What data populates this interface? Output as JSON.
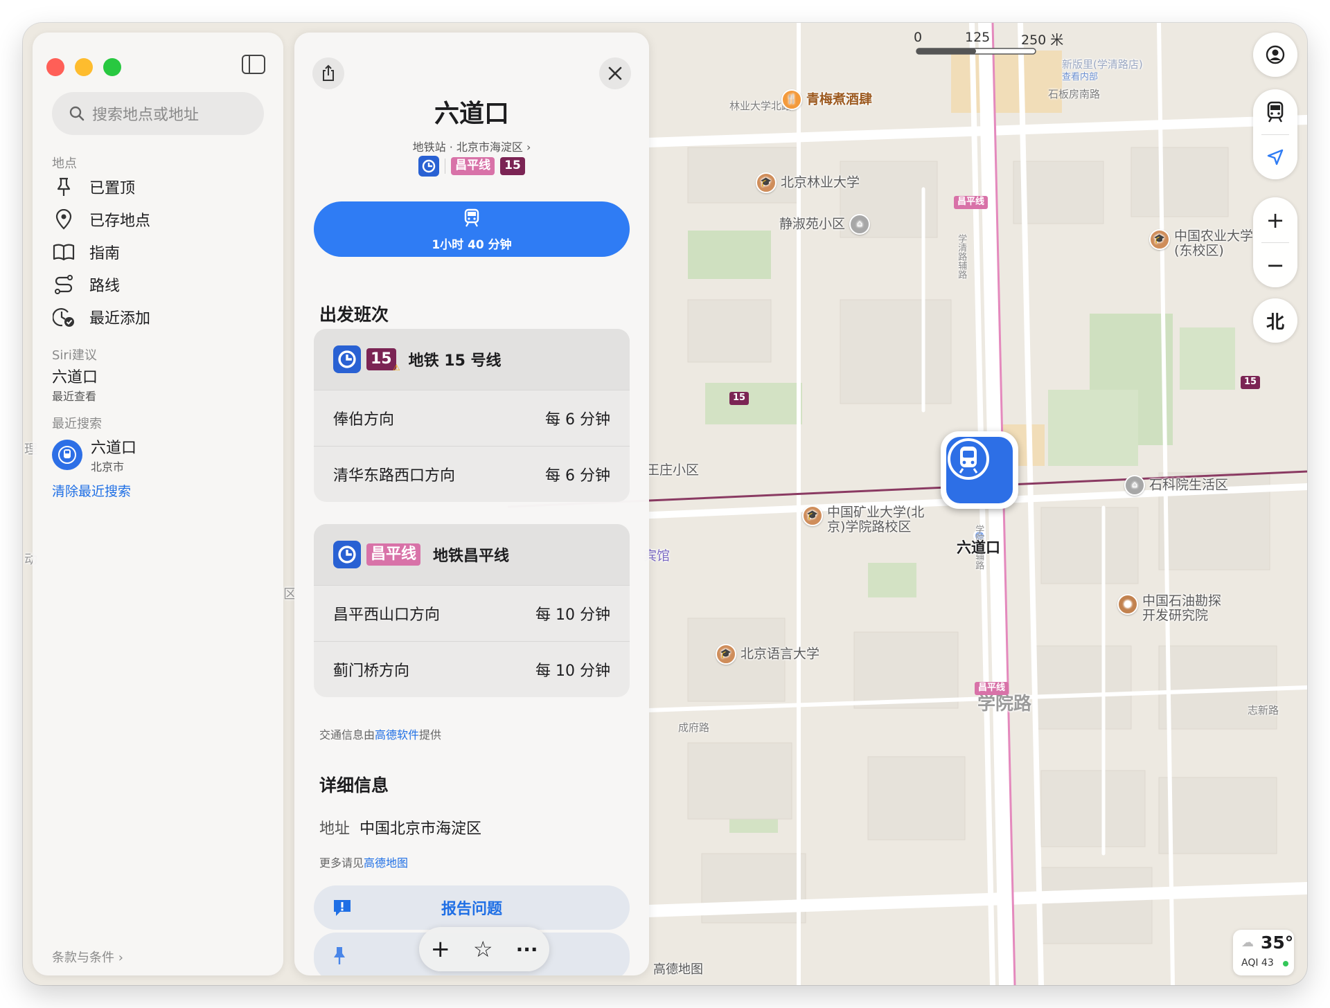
{
  "window": {
    "traffic_colors": {
      "close": "#ff5f57",
      "minimize": "#febc2e",
      "zoom": "#28c840"
    }
  },
  "sidebar": {
    "search_placeholder": "搜索地点或地址",
    "places_heading": "地点",
    "items": [
      {
        "label": "已置顶",
        "icon": "pin-icon"
      },
      {
        "label": "已存地点",
        "icon": "location-pin-icon"
      },
      {
        "label": "指南",
        "icon": "book-icon"
      },
      {
        "label": "路线",
        "icon": "route-icon"
      },
      {
        "label": "最近添加",
        "icon": "clock-check-icon"
      }
    ],
    "siri_heading": "Siri建议",
    "siri_item": {
      "title": "六道口",
      "subtitle": "最近查看"
    },
    "recent_heading": "最近搜索",
    "recent_item": {
      "title": "六道口",
      "subtitle": "北京市"
    },
    "clear_recent": "清除最近搜索",
    "terms": "条款与条件 ›"
  },
  "panel": {
    "title": "六道口",
    "subtitle": "地铁站 · 北京市海淀区 ›",
    "badge_changping": "昌平线",
    "badge_15": "15",
    "route_button": "1小时 40 分钟",
    "departures_heading": "出发班次",
    "lines": [
      {
        "badge": "15",
        "name": "地铁 15 号线",
        "color": "#7b2454",
        "directions": [
          {
            "direction": "俸伯方向",
            "frequency": "每 6 分钟"
          },
          {
            "direction": "清华东路西口方向",
            "frequency": "每 6 分钟"
          }
        ]
      },
      {
        "badge": "昌平线",
        "name": "地铁昌平线",
        "color": "#d872a8",
        "directions": [
          {
            "direction": "昌平西山口方向",
            "frequency": "每 10 分钟"
          },
          {
            "direction": "蓟门桥方向",
            "frequency": "每 10 分钟"
          }
        ]
      }
    ],
    "provider_prefix": "交通信息由",
    "provider_link": "高德软件",
    "provider_suffix": "提供",
    "details_heading": "详细信息",
    "address_label": "地址",
    "address_value": "中国北京市海淀区",
    "more_prefix": "更多请见",
    "more_link": "高德地图",
    "report_button": "报告问题"
  },
  "map": {
    "scale": {
      "zero": "0",
      "mid": "125",
      "max": "250 米"
    },
    "compass": "北",
    "station_label": "六道口",
    "road_main": "学院路",
    "weather": {
      "temp": "35°",
      "aqi": "AQI 43"
    },
    "attribution": "高德地图",
    "labels": {
      "qingmei": "青梅煮酒肆",
      "linye_north": "林业大学北路",
      "shiban": "石板房南路",
      "xinfang": "新版里(学清路店)",
      "xinfang_sub": "查看内部",
      "bjfu": "北京林业大学",
      "jingshuyuan": "静淑苑小区",
      "cau_1": "中国农业大学",
      "cau_2": "(东校区)",
      "wangzhuang": "王庄小区",
      "shikeyuan": "石科院生活区",
      "cumt_1": "中国矿业大学(北",
      "cumt_2": "京)学院路校区",
      "binguan": "宾馆",
      "petro_1": "中国石油勘探",
      "petro_2": "开发研究院",
      "blcu": "北京语言大学",
      "chengfu": "成府路",
      "zhixin": "志新路",
      "xueqing_side": "学清路辅路",
      "xueyuan_side": "学院路辅路",
      "left_edge_1": "理",
      "left_edge_2": "动",
      "left_edge_3": "区"
    },
    "line_labels": {
      "changping": "昌平线",
      "line15": "15"
    }
  }
}
